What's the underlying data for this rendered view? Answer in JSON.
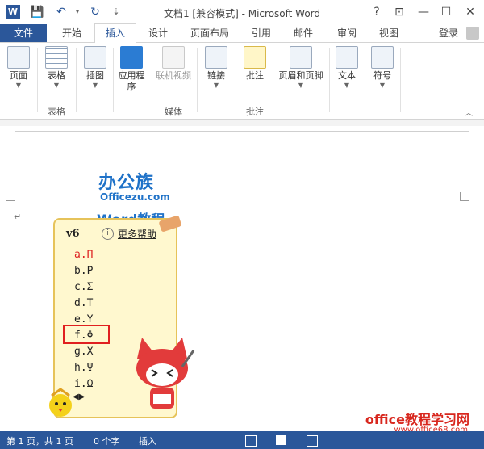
{
  "window": {
    "title": "文档1 [兼容模式] - Microsoft Word",
    "help": "?",
    "restore_ribbon": "⊡",
    "minimize": "—",
    "maximize": "☐",
    "close": "✕"
  },
  "quick_access": {
    "app_icon": "W",
    "save": "💾",
    "undo": "↶",
    "undo_arrow": "▾",
    "redo": "↻",
    "customize": "⇣"
  },
  "tabs": [
    "文件",
    "开始",
    "插入",
    "设计",
    "页面布局",
    "引用",
    "邮件",
    "审阅",
    "视图"
  ],
  "login": "登录",
  "ribbon": {
    "buttons": [
      {
        "label": "页面",
        "icon": "page-icon"
      },
      {
        "label": "表格",
        "icon": "table-icon"
      },
      {
        "label": "插图",
        "icon": "illustration-icon"
      },
      {
        "label": "应用程\n序",
        "icon": "apps-icon"
      },
      {
        "label": "联机视频",
        "icon": "video-icon"
      },
      {
        "label": "链接",
        "icon": "link-icon"
      },
      {
        "label": "批注",
        "icon": "comment-icon"
      },
      {
        "label": "页眉和页脚",
        "icon": "header-footer-icon"
      },
      {
        "label": "文本",
        "icon": "text-icon"
      },
      {
        "label": "符号",
        "icon": "symbol-icon"
      }
    ],
    "groups": [
      "表格",
      "媒体",
      "批注"
    ]
  },
  "document": {
    "watermark_title": "办公族",
    "watermark_url": "Officezu.com",
    "watermark_tutorial": "Word教程"
  },
  "ime_popup": {
    "typed": "v6",
    "help": "更多帮助",
    "candidates": [
      "a.Π",
      "b.Ρ",
      "c.Σ",
      "d.Τ",
      "e.Υ",
      "f.Φ",
      "g.Χ",
      "h.Ψ",
      "i.Ω"
    ],
    "highlighted_index": 5,
    "nav": "◀▶"
  },
  "statusbar": {
    "page": "第 1 页，共 1 页",
    "words": "0 个字",
    "mode": "插入"
  },
  "site": {
    "name": "office教程学习网",
    "url": "www.office68.com"
  }
}
